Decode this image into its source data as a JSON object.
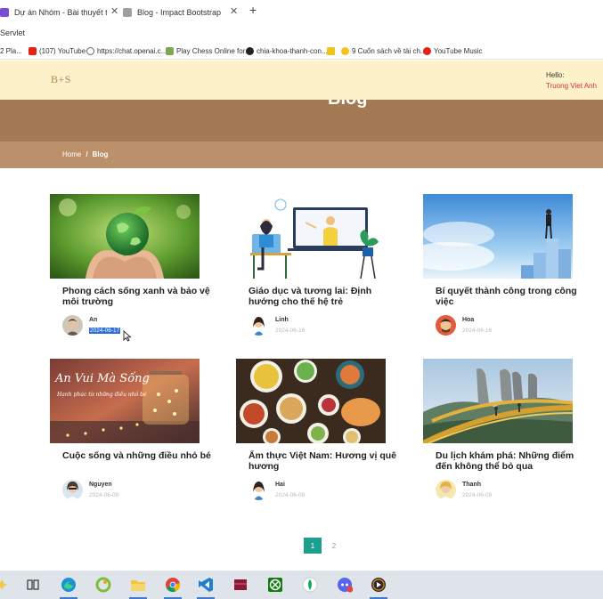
{
  "browser": {
    "tabs": [
      {
        "title": "Dự án Nhóm - Bài thuyết trình",
        "icon": "slides-icon"
      },
      {
        "title": "Blog - Impact Bootstrap Tem",
        "icon": "page-icon",
        "active": true
      }
    ],
    "address_text": "Servlet",
    "bookmarks": [
      {
        "label": "2 Pla..."
      },
      {
        "label": "(107) YouTube"
      },
      {
        "label": "https://chat.openai.c..."
      },
      {
        "label": "Play Chess Online for..."
      },
      {
        "label": "chia-khoa-thanh-con..."
      },
      {
        "label": "9 Cuốn sách về tài ch..."
      },
      {
        "label": "YouTube Music"
      }
    ]
  },
  "header": {
    "logo": "B+S",
    "greeting": "Hello:",
    "username": "Truong Viet Anh"
  },
  "hero": {
    "title": "Blog",
    "breadcrumb_home": "Home",
    "breadcrumb_sep": "/",
    "breadcrumb_current": "Blog"
  },
  "posts": [
    {
      "title": "Phong cách sống xanh và bảo vệ môi trường",
      "author": "An",
      "date": "2024-06-17",
      "image": "green-earth-hands"
    },
    {
      "title": "Giáo dục và tương lai: Định hướng cho thế hệ trẻ",
      "author": "Linh",
      "date": "2024-06-16",
      "image": "online-teaching-illustration"
    },
    {
      "title": "Bí quyết thành công trong công việc",
      "author": "Hoa",
      "date": "2024-06-16",
      "image": "businessman-on-stairs"
    },
    {
      "title": "Cuộc sống và những điều nhỏ bé",
      "author": "Nguyen",
      "date": "2024-06-09",
      "image": "fairy-light-jar"
    },
    {
      "title": "Ẩm thực Việt Nam: Hương vị quê hương",
      "author": "Hai",
      "date": "2024-06-09",
      "image": "vietnamese-food-table"
    },
    {
      "title": "Du lịch khám phá: Những điểm đến không thể bỏ qua",
      "author": "Thanh",
      "date": "2024-06-09",
      "image": "golden-bridge-hands"
    }
  ],
  "pagination": {
    "pages": [
      "1",
      "2"
    ],
    "current": "1"
  },
  "thumbnail_texts": {
    "jar_line1": "An Vui Mà Sống",
    "jar_line2": "Hạnh phúc từ những điều nhỏ bé"
  },
  "colors": {
    "header_bg": "#fcf1c9",
    "hero_bg": "#a47a54",
    "accent": "#1e9e8f",
    "username": "#d9342b"
  },
  "taskbar": {
    "icons": [
      "copilot-icon",
      "task-view-icon",
      "edge-icon",
      "greenshot-icon",
      "file-explorer-icon",
      "chrome-icon",
      "vscode-icon",
      "winrar-icon",
      "xbox-icon",
      "mongodb-icon",
      "discord-icon",
      "media-player-icon"
    ]
  }
}
